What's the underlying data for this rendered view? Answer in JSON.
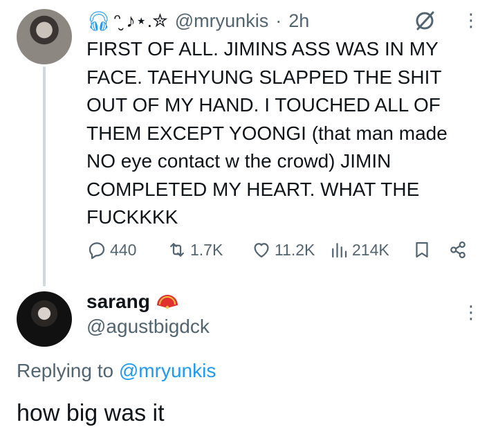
{
  "tweet": {
    "display_name_suffix": "ᵔ̮ ♪⋆.✮",
    "handle": "@mryunkis",
    "separator": "·",
    "time": "2h",
    "text": "FIRST OF ALL. JIMINS ASS WAS IN MY\nFACE. TAEHYUNG SLAPPED THE SHIT\nOUT OF MY HAND. I TOUCHED ALL OF\nTHEM EXCEPT YOONGI (that man made\nNO eye contact w the crowd) JIMIN\nCOMPLETED MY HEART. WHAT THE\nFUCKKKK",
    "metrics": {
      "replies": "440",
      "retweets": "1.7K",
      "likes": "11.2K",
      "views": "214K"
    }
  },
  "reply": {
    "display_name": "sarang",
    "handle": "@agustbigdck",
    "replying_prefix": "Replying to",
    "replying_to": "@mryunkis",
    "text": "how big was it"
  },
  "icons": {
    "headphones": "headphones-icon",
    "grok": "grok-icon",
    "more": "more-vertical-icon",
    "reply": "reply-icon",
    "retweet": "retweet-icon",
    "like": "heart-icon",
    "views": "views-icon",
    "bookmark": "bookmark-icon",
    "share": "share-icon",
    "fan": "fan-emoji-icon"
  },
  "colors": {
    "accent": "#1d9bf0",
    "secondary_text": "#536471",
    "primary_text": "#0f1419",
    "thread_line": "#cfd9de"
  }
}
